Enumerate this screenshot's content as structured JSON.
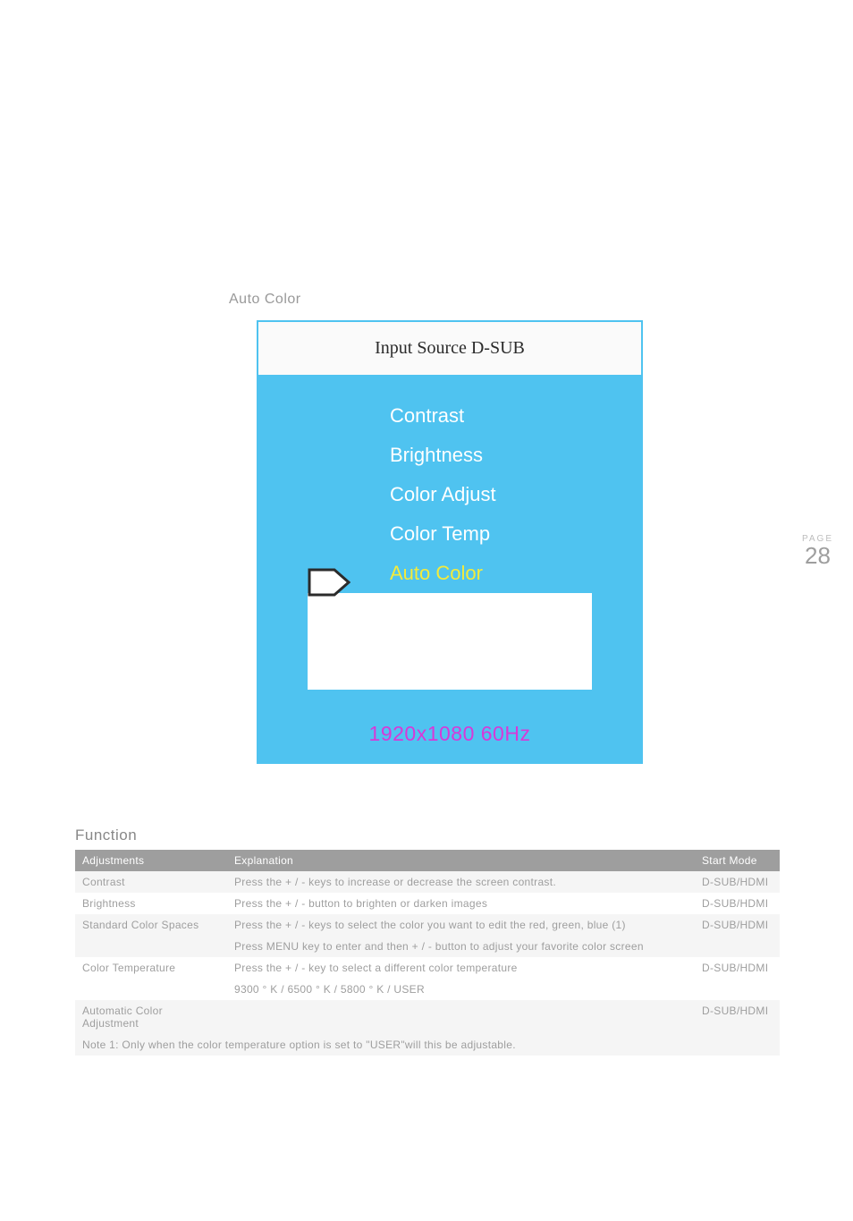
{
  "section_title": "Auto Color",
  "osd": {
    "header": "Input Source D-SUB",
    "items": [
      "Contrast",
      "Brightness",
      "Color Adjust",
      "Color Temp",
      "Auto Color"
    ],
    "selected_index": 4,
    "resolution": "1920x1080 60Hz"
  },
  "page": {
    "label": "PAGE",
    "number": "28"
  },
  "function": {
    "title": "Function",
    "headers": {
      "adjustments": "Adjustments",
      "explanation": "Explanation",
      "start_mode": "Start Mode"
    },
    "rows": [
      {
        "adj": "Contrast",
        "exp": "Press the + / - keys to increase or decrease the screen contrast.",
        "mode": "D-SUB/HDMI"
      },
      {
        "adj": "Brightness",
        "exp": "Press the + / - button to brighten or darken images",
        "mode": "D-SUB/HDMI"
      },
      {
        "adj": "Standard Color Spaces",
        "exp": "Press the + / - keys to select the color you want to edit the red, green, blue (1)",
        "mode": "D-SUB/HDMI"
      },
      {
        "adj": "",
        "exp": "Press MENU key to enter and then + / - button to adjust your favorite color screen",
        "mode": ""
      },
      {
        "adj": "Color Temperature",
        "exp": "Press the + / - key to select a different color temperature",
        "mode": "D-SUB/HDMI"
      },
      {
        "adj": "",
        "exp": "9300 ° K / 6500 ° K / 5800 ° K / USER",
        "mode": ""
      },
      {
        "adj": "Automatic Color Adjustment",
        "exp": "",
        "mode": "D-SUB/HDMI"
      }
    ],
    "note": "Note 1: Only when the color temperature option is set to \"USER\"will this be adjustable."
  }
}
